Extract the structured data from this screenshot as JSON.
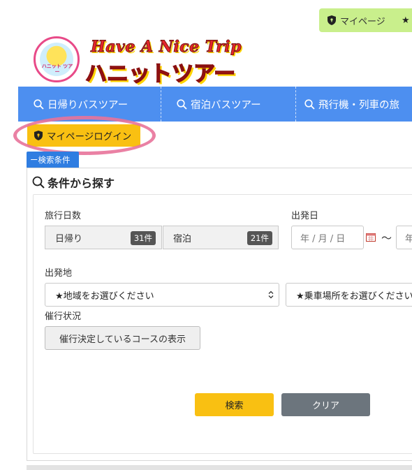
{
  "header": {
    "mypage_label": "マイページ",
    "favorite_icon": "star-icon",
    "logo": {
      "title_en": "Have A Nice Trip",
      "title_jp": "ハニットツアー",
      "badge_text": "ハニット ツアー"
    }
  },
  "nav": {
    "items": [
      {
        "label": "日帰りバスツアー",
        "icon": "search-icon"
      },
      {
        "label": "宿泊バスツアー",
        "icon": "search-icon"
      },
      {
        "label": "飛行機・列車の旅",
        "icon": "search-icon"
      }
    ]
  },
  "login": {
    "label": "マイページログイン",
    "icon": "shield-icon"
  },
  "search_panel": {
    "tab_label": "ー検索条件",
    "title": "条件から探す",
    "duration": {
      "label": "旅行日数",
      "options": [
        {
          "label": "日帰り",
          "count": "31件"
        },
        {
          "label": "宿泊",
          "count": "21件"
        }
      ]
    },
    "departure_date": {
      "label": "出発日",
      "from_placeholder": "年 / 月 / 日",
      "separator": "〜",
      "to_placeholder": "年"
    },
    "departure_place": {
      "label": "出発地",
      "region_select": "★地域をお選びください",
      "boarding_select": "★乗車場所をお選びください"
    },
    "status": {
      "label": "催行状況",
      "button": "催行決定しているコースの表示"
    },
    "search_button": "検索",
    "clear_button": "クリア"
  },
  "colors": {
    "nav_bg": "#4d8ff0",
    "accent_yellow": "#f9c012",
    "mypage_green": "#c9ef8c",
    "tab_blue": "#2f7de1",
    "clear_gray": "#6c757d",
    "highlight_pink": "#e8739a"
  }
}
